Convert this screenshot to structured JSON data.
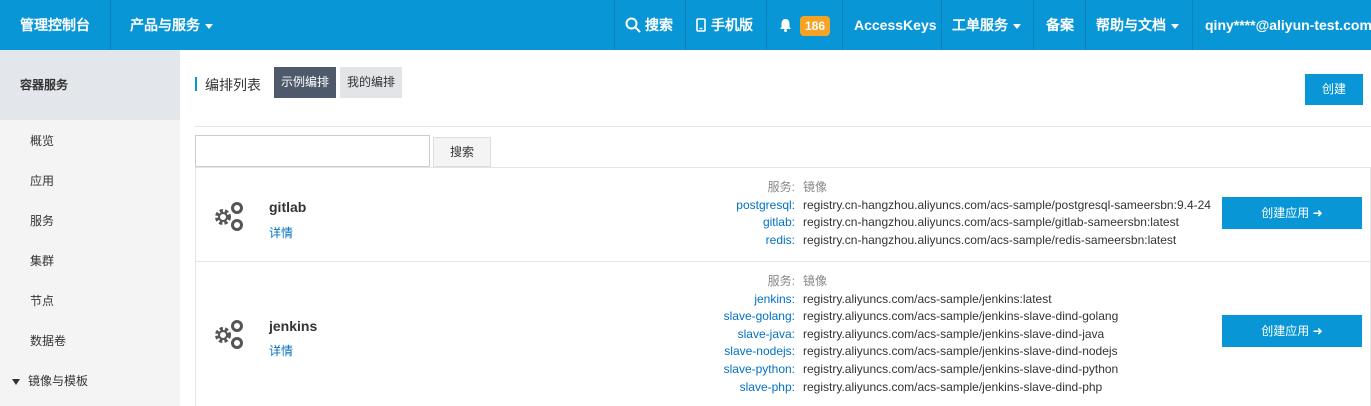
{
  "topbar": {
    "console": "管理控制台",
    "products": "产品与服务",
    "search": "搜索",
    "mobile": "手机版",
    "notifications": "186",
    "accesskeys": "AccessKeys",
    "ticket": "工单服务",
    "beian": "备案",
    "help": "帮助与文档",
    "user": "qiny****@aliyun-test.com"
  },
  "sidebar": {
    "header": "容器服务",
    "items": [
      "概览",
      "应用",
      "服务",
      "集群",
      "节点",
      "数据卷"
    ],
    "group": "镜像与模板"
  },
  "main": {
    "title": "编排列表",
    "tab_sample": "示例编排",
    "tab_mine": "我的编排",
    "create": "创建",
    "search_placeholder": "",
    "search_button": "搜索"
  },
  "templates": [
    {
      "name": "gitlab",
      "detail": "详情",
      "header_key": "服务:",
      "header_val": "镜像",
      "services": [
        {
          "service": "postgresql:",
          "image": "registry.cn-hangzhou.aliyuncs.com/acs-sample/postgresql-sameersbn:9.4-24"
        },
        {
          "service": "gitlab:",
          "image": "registry.cn-hangzhou.aliyuncs.com/acs-sample/gitlab-sameersbn:latest"
        },
        {
          "service": "redis:",
          "image": "registry.cn-hangzhou.aliyuncs.com/acs-sample/redis-sameersbn:latest"
        }
      ],
      "button": "创建应用 ➜"
    },
    {
      "name": "jenkins",
      "detail": "详情",
      "header_key": "服务:",
      "header_val": "镜像",
      "services": [
        {
          "service": "jenkins:",
          "image": "registry.aliyuncs.com/acs-sample/jenkins:latest"
        },
        {
          "service": "slave-golang:",
          "image": "registry.aliyuncs.com/acs-sample/jenkins-slave-dind-golang"
        },
        {
          "service": "slave-java:",
          "image": "registry.aliyuncs.com/acs-sample/jenkins-slave-dind-java"
        },
        {
          "service": "slave-nodejs:",
          "image": "registry.aliyuncs.com/acs-sample/jenkins-slave-dind-nodejs"
        },
        {
          "service": "slave-python:",
          "image": "registry.aliyuncs.com/acs-sample/jenkins-slave-dind-python"
        },
        {
          "service": "slave-php:",
          "image": "registry.aliyuncs.com/acs-sample/jenkins-slave-dind-php"
        }
      ],
      "button": "创建应用 ➜"
    }
  ],
  "colors": {
    "topbar": "#0996d6",
    "badge": "#f6a325",
    "link": "#0071c5",
    "active_tab": "#4e5a6b"
  },
  "icons": {
    "search": "search-icon",
    "mobile": "mobile-icon",
    "bell": "bell-icon",
    "template": "gears-icon"
  }
}
